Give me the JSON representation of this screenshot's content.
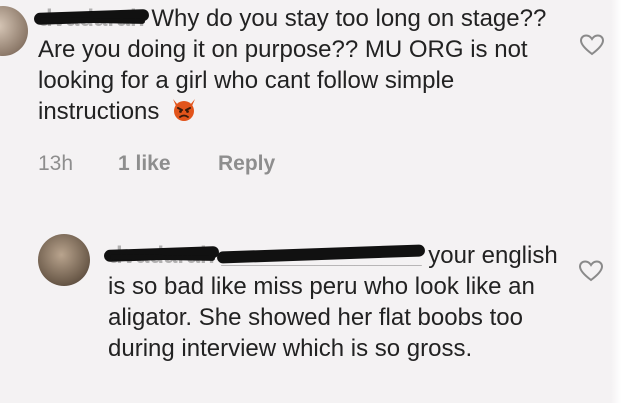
{
  "comments": [
    {
      "username": "dvadarah",
      "text": "Why do you stay too long on stage?? Are you doing it on purpose?? MU ORG is not looking for a girl who cant follow simple instructions",
      "emoji": "angry-devil-emoji",
      "time": "13h",
      "likes": "1 like",
      "reply": "Reply",
      "icon": "heart-icon"
    },
    {
      "username": "dvadarah",
      "mention": "_______________",
      "text": "your english is so bad like miss peru who look like an aligator. She showed her flat boobs too during interview which is so gross.",
      "icon": "heart-icon"
    }
  ]
}
